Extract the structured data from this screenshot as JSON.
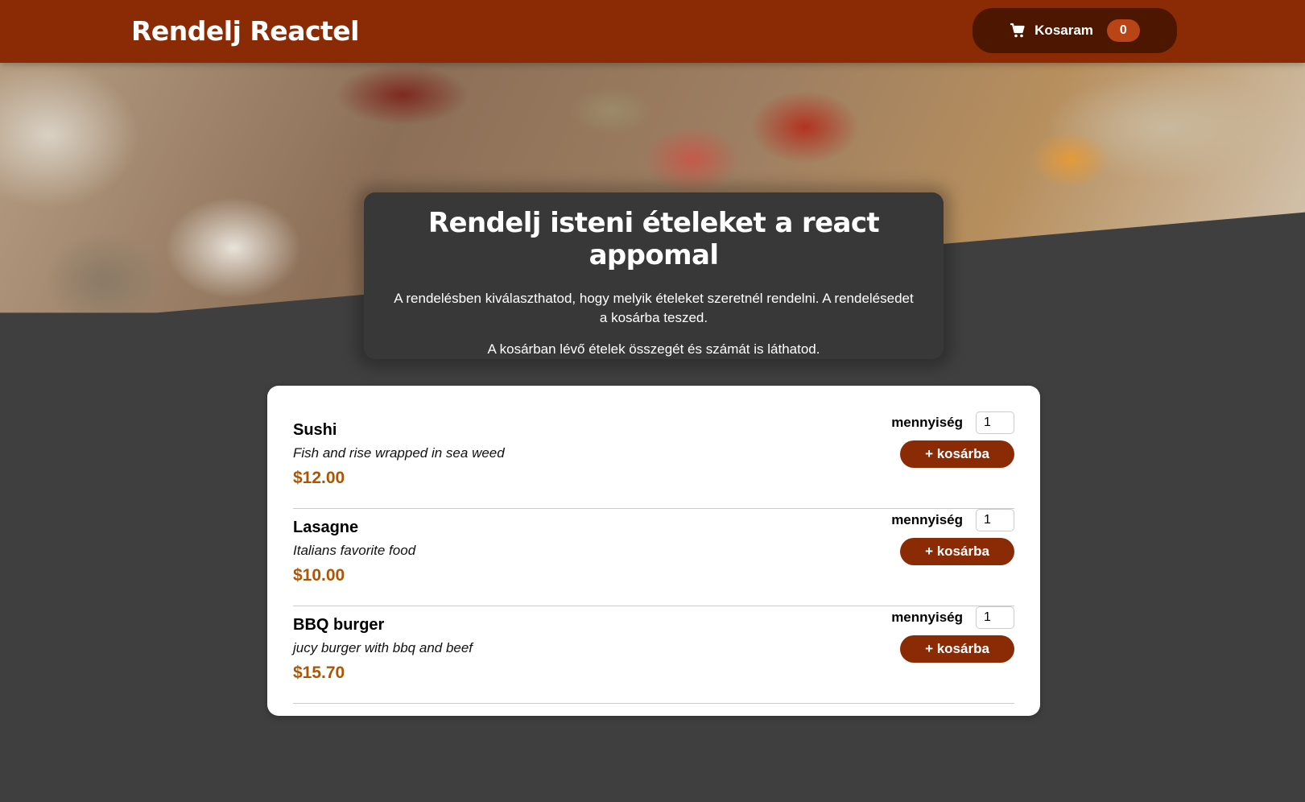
{
  "header": {
    "title": "Rendelj Reactel",
    "cart": {
      "label": "Kosaram",
      "count": "0",
      "icon": "cart-icon"
    }
  },
  "summary": {
    "heading": "Rendelj isteni ételeket a react appomal",
    "paragraph1": "A rendelésben kiválaszthatod, hogy melyik ételeket szeretnél rendelni. A rendelésedet a kosárba teszed.",
    "paragraph2": "A kosárban lévő ételek összegét és számát is láthatod."
  },
  "meals": [
    {
      "name": "Sushi",
      "description": "Fish and rise wrapped in sea weed",
      "price": "$12.00",
      "amount_label": "mennyiség",
      "amount": "1",
      "add_label": "+ kosárba"
    },
    {
      "name": "Lasagne",
      "description": "Italians favorite food",
      "price": "$10.00",
      "amount_label": "mennyiség",
      "amount": "1",
      "add_label": "+ kosárba"
    },
    {
      "name": "BBQ burger",
      "description": "jucy burger with bbq and beef",
      "price": "$15.70",
      "amount_label": "mennyiség",
      "amount": "1",
      "add_label": "+ kosárba"
    }
  ],
  "colors": {
    "header_bg": "#8a2b06",
    "cart_bg": "#4d1601",
    "badge_bg": "#b94517",
    "page_bg": "#3f3f3f",
    "price": "#ad5502"
  }
}
